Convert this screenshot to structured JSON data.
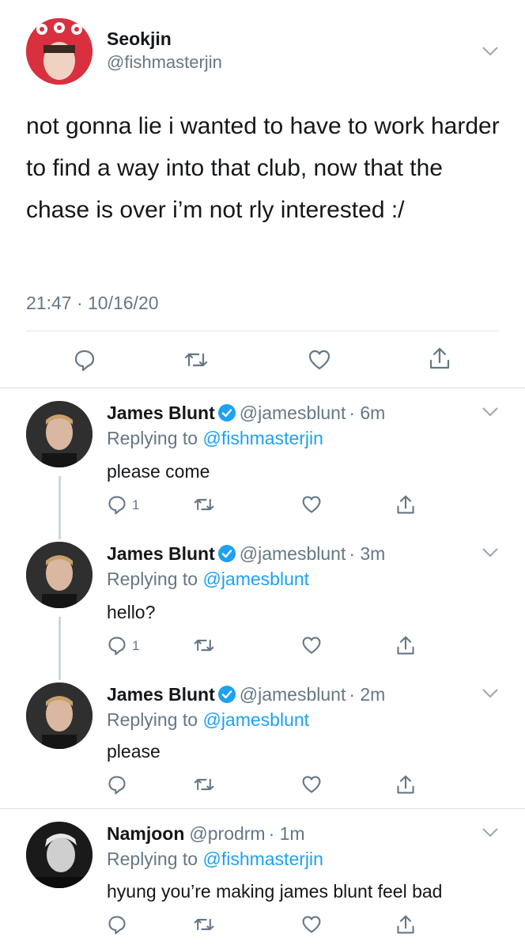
{
  "main_tweet": {
    "name": "Seokjin",
    "handle": "@fishmasterjin",
    "text": "not gonna lie i wanted to have to work harder to find a way into that club, now that the chase is over i’m not rly interested :/",
    "timestamp": "21:47 · 10/16/20",
    "actions": [
      "reply-icon",
      "retweet-icon",
      "like-icon",
      "share-icon"
    ]
  },
  "replies": [
    {
      "name": "James Blunt",
      "verified": true,
      "handle": "@jamesblunt",
      "time": "· 6m",
      "replying_prefix": "Replying to ",
      "replying_to": "@fishmasterjin",
      "text": "please come",
      "reply_count": "1"
    },
    {
      "name": "James Blunt",
      "verified": true,
      "handle": "@jamesblunt",
      "time": "· 3m",
      "replying_prefix": "Replying to ",
      "replying_to": "@jamesblunt",
      "text": "hello?",
      "reply_count": "1"
    },
    {
      "name": "James Blunt",
      "verified": true,
      "handle": "@jamesblunt",
      "time": "· 2m",
      "replying_prefix": "Replying to ",
      "replying_to": "@jamesblunt",
      "text": "please",
      "reply_count": ""
    },
    {
      "name": "Namjoon",
      "verified": false,
      "handle": "@prodrm",
      "time": "· 1m",
      "replying_prefix": "Replying to ",
      "replying_to": "@fishmasterjin",
      "text": "hyung you’re making james blunt feel bad",
      "reply_count": ""
    }
  ],
  "colors": {
    "link": "#1da1f2",
    "secondary_text": "#657786",
    "icon_gray": "#657786",
    "divider": "#e1e8ed"
  }
}
